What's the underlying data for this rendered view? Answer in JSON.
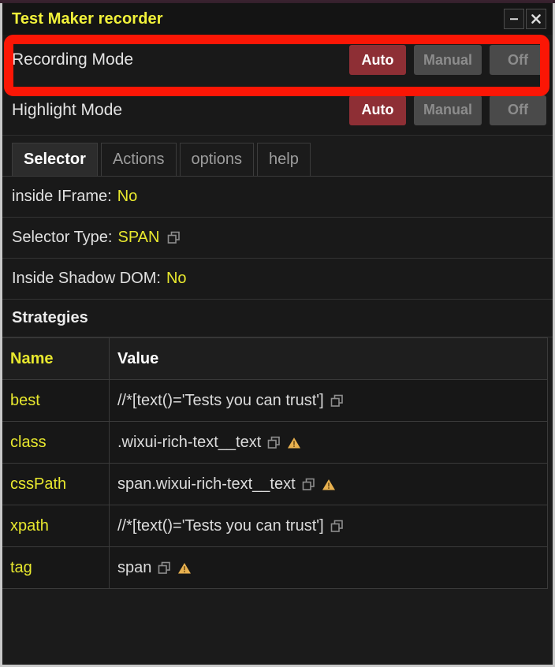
{
  "window": {
    "title": "Test Maker recorder",
    "minimize_label": "–",
    "close_label": "×"
  },
  "modes": [
    {
      "key": "recording",
      "label": "Recording Mode",
      "options": [
        "Auto",
        "Manual",
        "Off"
      ],
      "selected": "Auto",
      "highlighted": true
    },
    {
      "key": "highlight",
      "label": "Highlight Mode",
      "options": [
        "Auto",
        "Manual",
        "Off"
      ],
      "selected": "Auto",
      "highlighted": false
    }
  ],
  "tabs": [
    {
      "label": "Selector",
      "active": true
    },
    {
      "label": "Actions",
      "active": false
    },
    {
      "label": "options",
      "active": false
    },
    {
      "label": "help",
      "active": false
    }
  ],
  "info_rows": [
    {
      "label": "inside IFrame:",
      "value": "No",
      "copy": false
    },
    {
      "label": "Selector Type:",
      "value": "SPAN",
      "copy": true
    },
    {
      "label": "Inside Shadow DOM:",
      "value": "No",
      "copy": false
    }
  ],
  "strategies": {
    "heading": "Strategies",
    "columns": [
      "Name",
      "Value"
    ],
    "rows": [
      {
        "name": "best",
        "value": "//*[text()='Tests you can trust']",
        "copy": true,
        "warn": false
      },
      {
        "name": "class",
        "value": ".wixui-rich-text__text",
        "copy": true,
        "warn": true
      },
      {
        "name": "cssPath",
        "value": "span.wixui-rich-text__text",
        "copy": true,
        "warn": true
      },
      {
        "name": "xpath",
        "value": "//*[text()='Tests you can trust']",
        "copy": true,
        "warn": false
      },
      {
        "name": "tag",
        "value": "span",
        "copy": true,
        "warn": true
      }
    ]
  },
  "icons": {
    "minimize": "minimize-icon",
    "close": "close-icon",
    "copy": "copy-icon",
    "warning": "warning-icon"
  },
  "colors": {
    "title": "#f2f23a",
    "accent_yellow": "#e8e82e",
    "active_button": "#8e2f35",
    "inactive_button": "#4a4a4a",
    "highlight_box": "#fb1605",
    "warning": "#e8b14f",
    "panel_bg": "#191919",
    "window_border": "#c9c9c9"
  }
}
